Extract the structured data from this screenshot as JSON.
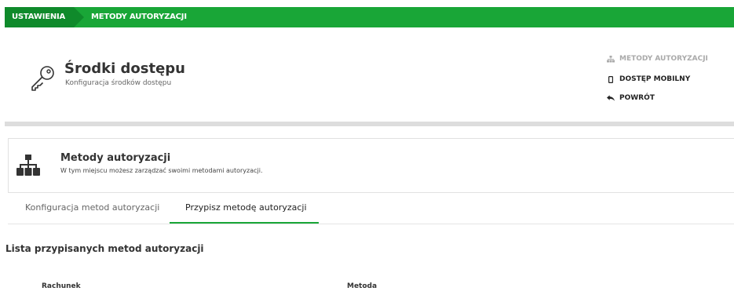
{
  "breadcrumb": {
    "items": [
      {
        "label": "USTAWIENIA"
      },
      {
        "label": "METODY AUTORYZACJI"
      }
    ]
  },
  "header": {
    "icon": "key-icon",
    "title": "Środki dostępu",
    "subtitle": "Konfiguracja środków dostępu"
  },
  "side_links": [
    {
      "icon": "sitemap-icon",
      "label": "METODY AUTORYZACJI",
      "active": true
    },
    {
      "icon": "mobile-icon",
      "label": "DOSTĘP MOBILNY"
    },
    {
      "icon": "back-arrow-icon",
      "label": "POWRÓT"
    }
  ],
  "section": {
    "icon": "sitemap-icon",
    "title": "Metody autoryzacji",
    "description": "W tym miejscu możesz zarządzać swoimi metodami autoryzacji."
  },
  "tabs": [
    {
      "label": "Konfiguracja metod autoryzacji"
    },
    {
      "label": "Przypisz metodę autoryzacji",
      "selected": true
    }
  ],
  "list": {
    "title": "Lista przypisanych metod autoryzacji",
    "columns": [
      "Rachunek",
      "Metoda"
    ]
  },
  "colors": {
    "accent": "#19a637",
    "accent_dark": "#0f8a2b"
  }
}
